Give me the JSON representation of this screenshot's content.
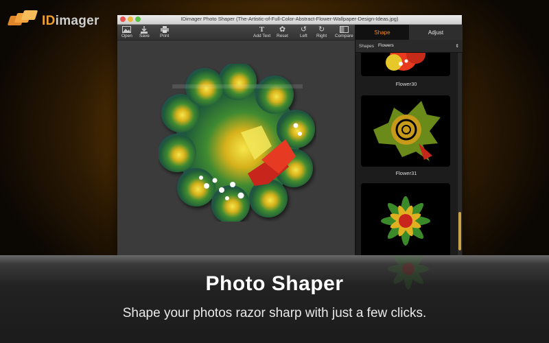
{
  "brand": {
    "prefix": "ID",
    "suffix": "imager"
  },
  "window": {
    "title": "IDimager Photo Shaper (The-Artistic-of-Full-Color-Abstract-Flower-Wallpaper-Design-Ideas.jpg)"
  },
  "toolbar": {
    "open": "Open",
    "save": "Save",
    "print": "Print",
    "add_text": "Add Text",
    "reset": "Reset",
    "left": "Left",
    "right": "Right",
    "compare": "Compare"
  },
  "panel": {
    "tabs": {
      "shape": "Shape",
      "adjust": "Adjust"
    },
    "shapes_label": "Shapes",
    "shapes_value": "Flowers",
    "items": [
      {
        "label": "Flower30"
      },
      {
        "label": "Flower31"
      }
    ]
  },
  "colors": {
    "accent": "#f08a1a",
    "scroll_thumb": "#c9a24a"
  },
  "caption": {
    "title": "Photo Shaper",
    "subtitle": "Shape your photos razor sharp with just a few clicks."
  }
}
